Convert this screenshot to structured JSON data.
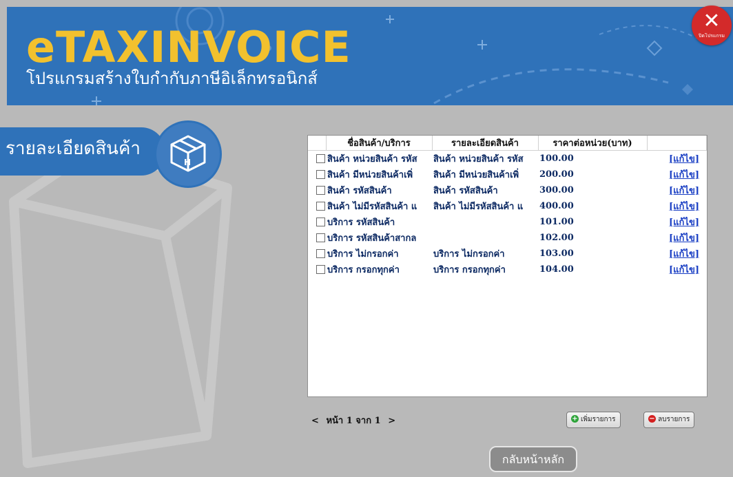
{
  "header": {
    "logo_text": "eTAXINVOICE",
    "subtitle": "โปรแกรมสร้างใบกำกับภาษีอิเล็กทรอนิกส์",
    "close_label": "ปิดโปรแกรม",
    "close_icon": "close-icon"
  },
  "section": {
    "title": "รายละเอียดสินค้า",
    "icon": "box-icon"
  },
  "grid": {
    "columns": [
      "",
      "ชื่อสินค้า/บริการ",
      "รายละเอียดสินค้า",
      "ราคาต่อหน่วย(บาท)",
      ""
    ],
    "rows": [
      {
        "name": "สินค้า หน่วยสินค้า รหัส",
        "detail": "สินค้า หน่วยสินค้า รหัส",
        "price": "100.00",
        "edit": "[แก้ไข]"
      },
      {
        "name": "สินค้า มีหน่วยสินค้าเพิ่",
        "detail": "สินค้า มีหน่วยสินค้าเพิ่",
        "price": "200.00",
        "edit": "[แก้ไข]"
      },
      {
        "name": "สินค้า รหัสสินค้า",
        "detail": "สินค้า รหัสสินค้า",
        "price": "300.00",
        "edit": "[แก้ไข]"
      },
      {
        "name": "สินค้า ไม่มีรหัสสินค้า แ",
        "detail": "สินค้า ไม่มีรหัสสินค้า แ",
        "price": "400.00",
        "edit": "[แก้ไข]"
      },
      {
        "name": "บริการ รหัสสินค้า",
        "detail": "",
        "price": "101.00",
        "edit": "[แก้ไข]"
      },
      {
        "name": "บริการ รหัสสินค้าสากล",
        "detail": "",
        "price": "102.00",
        "edit": "[แก้ไข]"
      },
      {
        "name": "บริการ ไม่กรอกค่า",
        "detail": "บริการ ไม่กรอกค่า",
        "price": "103.00",
        "edit": "[แก้ไข]"
      },
      {
        "name": "บริการ กรอกทุกค่า",
        "detail": "บริการ กรอกทุกค่า",
        "price": "104.00",
        "edit": "[แก้ไข]"
      }
    ]
  },
  "pager": {
    "prev": "<",
    "text": "หน้า 1 จาก 1",
    "next": ">"
  },
  "buttons": {
    "add": "เพิ่มรายการ",
    "delete": "ลบรายการ",
    "home": "กลับหน้าหลัก"
  },
  "colors": {
    "header_bg": "#2f72b9",
    "logo": "#f2c12e",
    "close": "#d32a2a",
    "page_bg": "#b9b9b9"
  }
}
